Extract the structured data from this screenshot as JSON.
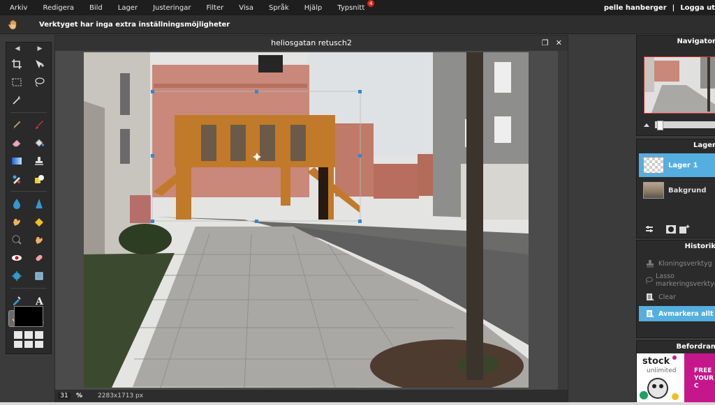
{
  "menu": {
    "items": [
      {
        "label": "Arkiv"
      },
      {
        "label": "Redigera"
      },
      {
        "label": "Bild"
      },
      {
        "label": "Lager"
      },
      {
        "label": "Justeringar"
      },
      {
        "label": "Filter"
      },
      {
        "label": "Visa"
      },
      {
        "label": "Språk"
      },
      {
        "label": "Hjälp"
      },
      {
        "label": "Typsnitt",
        "badge": "4"
      }
    ],
    "user": "pelle hanberger",
    "separator": "|",
    "logout": "Logga ut"
  },
  "options_bar": {
    "text": "Verktyget har inga extra inställningsmöjligheter"
  },
  "document": {
    "title": "heliosgatan retusch2",
    "zoom": "31",
    "zoom_unit": "%",
    "size": "2283x1713 px"
  },
  "panels": {
    "navigator": {
      "title": "Navigator"
    },
    "layers": {
      "title": "Lager",
      "items": [
        {
          "name": "Lager 1",
          "selected": true
        },
        {
          "name": "Bakgrund",
          "selected": false
        }
      ]
    },
    "history": {
      "title": "Historik",
      "items": [
        {
          "label": "Kloningsverktyg",
          "selected": false
        },
        {
          "label": "Lasso markeringsverktyg",
          "selected": false
        },
        {
          "label": "Clear",
          "selected": false
        },
        {
          "label": "Avmarkera allt",
          "selected": true
        }
      ]
    },
    "ad": {
      "title": "Befordran",
      "logo": "stock",
      "logo_sub": "unlimited",
      "line1": "FREE",
      "line2": "YOUR C"
    }
  },
  "colors": {
    "accent": "#55aee0",
    "menu_bg": "#1e1e1e",
    "primary_color": "#000000"
  }
}
